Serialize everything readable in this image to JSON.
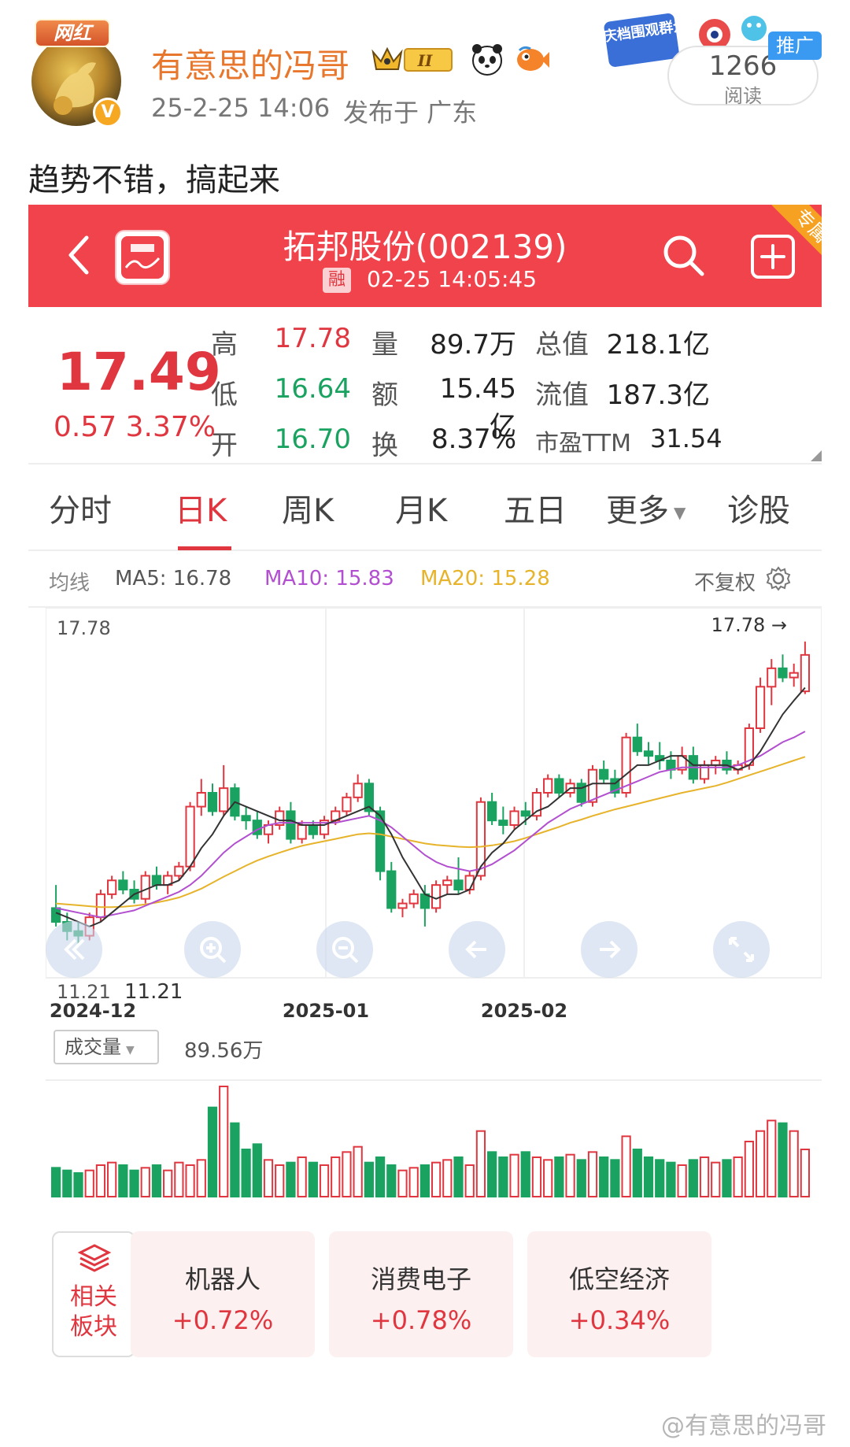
{
  "post": {
    "avatar_tag": "网红",
    "username": "有意思的冯哥",
    "level_badge": "II",
    "time": "25-2-25 14:06",
    "location": "发布于 广东",
    "read_count": "1266",
    "read_label": "阅读",
    "promo_label": "推广",
    "promo_art_text": "国庆档围观群众",
    "text": "趋势不错，搞起来"
  },
  "stock": {
    "name": "拓邦股份(002139)",
    "margin_badge": "融",
    "quote_time": "02-25 14:05:45",
    "ribbon": "专属",
    "price": "17.49",
    "change": "0.57 3.37%",
    "fields": [
      {
        "label": "高",
        "value": "17.78",
        "color": "red"
      },
      {
        "label": "量",
        "value": "89.7万",
        "color": "dark"
      },
      {
        "label": "总值",
        "value": "218.1亿",
        "color": "dark"
      },
      {
        "label": "低",
        "value": "16.64",
        "color": "green"
      },
      {
        "label": "额",
        "value": "15.45亿",
        "color": "dark"
      },
      {
        "label": "流值",
        "value": "187.3亿",
        "color": "dark"
      },
      {
        "label": "开",
        "value": "16.70",
        "color": "green"
      },
      {
        "label": "换",
        "value": "8.37%",
        "color": "dark"
      },
      {
        "label": "市盈TTM",
        "value": "31.54",
        "color": "dark"
      }
    ]
  },
  "tabs": [
    "分时",
    "日K",
    "周K",
    "月K",
    "五日",
    "更多",
    "诊股"
  ],
  "active_tab": "日K",
  "ma": {
    "label": "均线",
    "ma5": "MA5: 16.78",
    "ma10": "MA10: 15.83",
    "ma20": "MA20: 15.28",
    "adjust": "不复权"
  },
  "colors": {
    "up": "#e0363f",
    "down": "#1aa260",
    "ma5": "#333333",
    "ma10": "#b24fd0",
    "ma20": "#e6b32a"
  },
  "chart_data": {
    "type": "candlestick",
    "x_labels": [
      "2024-12",
      "2025-01",
      "2025-02"
    ],
    "high_label": "17.78",
    "high_marker_label": "17.78 →",
    "low_label": "11.21",
    "low_marker_label": "11.21",
    "ylim": [
      11.0,
      18.0
    ],
    "candles": [
      {
        "o": 12.0,
        "h": 12.5,
        "l": 11.6,
        "c": 11.7
      },
      {
        "o": 11.7,
        "h": 11.9,
        "l": 11.3,
        "c": 11.5
      },
      {
        "o": 11.5,
        "h": 11.7,
        "l": 11.21,
        "c": 11.4
      },
      {
        "o": 11.4,
        "h": 11.9,
        "l": 11.3,
        "c": 11.8
      },
      {
        "o": 11.8,
        "h": 12.4,
        "l": 11.7,
        "c": 12.3
      },
      {
        "o": 12.3,
        "h": 12.7,
        "l": 12.2,
        "c": 12.6
      },
      {
        "o": 12.6,
        "h": 12.8,
        "l": 12.3,
        "c": 12.4
      },
      {
        "o": 12.4,
        "h": 12.6,
        "l": 12.1,
        "c": 12.2
      },
      {
        "o": 12.2,
        "h": 12.8,
        "l": 12.1,
        "c": 12.7
      },
      {
        "o": 12.7,
        "h": 12.9,
        "l": 12.4,
        "c": 12.5
      },
      {
        "o": 12.5,
        "h": 12.8,
        "l": 12.3,
        "c": 12.7
      },
      {
        "o": 12.7,
        "h": 13.0,
        "l": 12.6,
        "c": 12.9
      },
      {
        "o": 12.9,
        "h": 14.3,
        "l": 12.8,
        "c": 14.2
      },
      {
        "o": 14.2,
        "h": 14.8,
        "l": 14.0,
        "c": 14.5
      },
      {
        "o": 14.5,
        "h": 14.7,
        "l": 14.0,
        "c": 14.1
      },
      {
        "o": 14.1,
        "h": 15.1,
        "l": 14.0,
        "c": 14.6
      },
      {
        "o": 14.6,
        "h": 14.7,
        "l": 13.9,
        "c": 14.0
      },
      {
        "o": 14.0,
        "h": 14.2,
        "l": 13.7,
        "c": 13.9
      },
      {
        "o": 13.9,
        "h": 14.1,
        "l": 13.5,
        "c": 13.6
      },
      {
        "o": 13.6,
        "h": 13.9,
        "l": 13.4,
        "c": 13.8
      },
      {
        "o": 13.8,
        "h": 14.2,
        "l": 13.7,
        "c": 14.1
      },
      {
        "o": 14.1,
        "h": 14.3,
        "l": 13.4,
        "c": 13.5
      },
      {
        "o": 13.5,
        "h": 13.9,
        "l": 13.4,
        "c": 13.8
      },
      {
        "o": 13.8,
        "h": 13.9,
        "l": 13.5,
        "c": 13.6
      },
      {
        "o": 13.6,
        "h": 14.0,
        "l": 13.5,
        "c": 13.9
      },
      {
        "o": 13.9,
        "h": 14.2,
        "l": 13.8,
        "c": 14.1
      },
      {
        "o": 14.1,
        "h": 14.5,
        "l": 14.0,
        "c": 14.4
      },
      {
        "o": 14.4,
        "h": 14.9,
        "l": 14.3,
        "c": 14.7
      },
      {
        "o": 14.7,
        "h": 14.8,
        "l": 14.0,
        "c": 14.1
      },
      {
        "o": 14.1,
        "h": 14.2,
        "l": 12.6,
        "c": 12.8
      },
      {
        "o": 12.8,
        "h": 13.0,
        "l": 11.9,
        "c": 12.0
      },
      {
        "o": 12.0,
        "h": 12.2,
        "l": 11.8,
        "c": 12.1
      },
      {
        "o": 12.1,
        "h": 12.4,
        "l": 12.0,
        "c": 12.3
      },
      {
        "o": 12.3,
        "h": 12.5,
        "l": 11.6,
        "c": 12.0
      },
      {
        "o": 12.0,
        "h": 12.6,
        "l": 11.9,
        "c": 12.5
      },
      {
        "o": 12.5,
        "h": 12.7,
        "l": 12.3,
        "c": 12.6
      },
      {
        "o": 12.6,
        "h": 13.1,
        "l": 12.3,
        "c": 12.4
      },
      {
        "o": 12.4,
        "h": 12.8,
        "l": 12.3,
        "c": 12.7
      },
      {
        "o": 12.7,
        "h": 14.4,
        "l": 12.6,
        "c": 14.3
      },
      {
        "o": 14.3,
        "h": 14.5,
        "l": 13.8,
        "c": 13.9
      },
      {
        "o": 13.9,
        "h": 14.2,
        "l": 13.6,
        "c": 13.8
      },
      {
        "o": 13.8,
        "h": 14.2,
        "l": 13.7,
        "c": 14.1
      },
      {
        "o": 14.1,
        "h": 14.3,
        "l": 13.8,
        "c": 14.0
      },
      {
        "o": 14.0,
        "h": 14.6,
        "l": 13.9,
        "c": 14.5
      },
      {
        "o": 14.5,
        "h": 14.9,
        "l": 14.4,
        "c": 14.8
      },
      {
        "o": 14.8,
        "h": 14.9,
        "l": 14.4,
        "c": 14.5
      },
      {
        "o": 14.5,
        "h": 14.8,
        "l": 14.4,
        "c": 14.7
      },
      {
        "o": 14.7,
        "h": 14.8,
        "l": 14.2,
        "c": 14.3
      },
      {
        "o": 14.3,
        "h": 15.1,
        "l": 14.2,
        "c": 15.0
      },
      {
        "o": 15.0,
        "h": 15.2,
        "l": 14.7,
        "c": 14.8
      },
      {
        "o": 14.8,
        "h": 15.0,
        "l": 14.4,
        "c": 14.5
      },
      {
        "o": 14.5,
        "h": 15.8,
        "l": 14.4,
        "c": 15.7
      },
      {
        "o": 15.7,
        "h": 16.0,
        "l": 15.3,
        "c": 15.4
      },
      {
        "o": 15.4,
        "h": 15.6,
        "l": 15.1,
        "c": 15.3
      },
      {
        "o": 15.3,
        "h": 15.6,
        "l": 15.0,
        "c": 15.2
      },
      {
        "o": 15.2,
        "h": 15.4,
        "l": 14.8,
        "c": 15.0
      },
      {
        "o": 15.0,
        "h": 15.5,
        "l": 14.9,
        "c": 15.3
      },
      {
        "o": 15.3,
        "h": 15.5,
        "l": 14.7,
        "c": 14.8
      },
      {
        "o": 14.8,
        "h": 15.2,
        "l": 14.7,
        "c": 15.1
      },
      {
        "o": 15.1,
        "h": 15.3,
        "l": 14.9,
        "c": 15.2
      },
      {
        "o": 15.2,
        "h": 15.4,
        "l": 14.9,
        "c": 15.0
      },
      {
        "o": 15.0,
        "h": 15.2,
        "l": 14.9,
        "c": 15.1
      },
      {
        "o": 15.1,
        "h": 16.0,
        "l": 15.0,
        "c": 15.9
      },
      {
        "o": 15.9,
        "h": 17.0,
        "l": 15.8,
        "c": 16.8
      },
      {
        "o": 16.8,
        "h": 17.4,
        "l": 16.4,
        "c": 17.2
      },
      {
        "o": 17.2,
        "h": 17.5,
        "l": 16.9,
        "c": 17.0
      },
      {
        "o": 17.0,
        "h": 17.3,
        "l": 16.8,
        "c": 17.1
      },
      {
        "o": 16.7,
        "h": 17.78,
        "l": 16.64,
        "c": 17.49
      }
    ],
    "ma5": [
      11.9,
      11.8,
      11.7,
      11.6,
      11.7,
      11.9,
      12.1,
      12.3,
      12.4,
      12.5,
      12.5,
      12.6,
      12.9,
      13.3,
      13.6,
      14.0,
      14.3,
      14.2,
      14.1,
      14.0,
      13.9,
      13.9,
      13.8,
      13.8,
      13.8,
      13.9,
      14.0,
      14.1,
      14.2,
      14.0,
      13.6,
      13.1,
      12.7,
      12.3,
      12.2,
      12.3,
      12.3,
      12.4,
      12.9,
      13.2,
      13.4,
      13.7,
      13.9,
      14.1,
      14.2,
      14.4,
      14.6,
      14.6,
      14.7,
      14.7,
      14.7,
      14.9,
      15.1,
      15.1,
      15.2,
      15.3,
      15.3,
      15.1,
      15.1,
      15.1,
      15.1,
      15.0,
      15.1,
      15.4,
      15.8,
      16.2,
      16.5,
      16.78
    ],
    "ma10": [
      12.0,
      11.95,
      11.9,
      11.85,
      11.8,
      11.85,
      11.9,
      11.95,
      12.05,
      12.15,
      12.25,
      12.35,
      12.5,
      12.7,
      12.95,
      13.2,
      13.4,
      13.55,
      13.7,
      13.8,
      13.85,
      13.85,
      13.85,
      13.85,
      13.85,
      13.85,
      13.9,
      13.95,
      14.0,
      13.9,
      13.75,
      13.55,
      13.35,
      13.15,
      13.0,
      12.9,
      12.85,
      12.8,
      12.85,
      12.95,
      13.1,
      13.25,
      13.45,
      13.65,
      13.85,
      14.0,
      14.15,
      14.25,
      14.35,
      14.45,
      14.55,
      14.65,
      14.75,
      14.85,
      14.95,
      15.0,
      15.05,
      15.05,
      15.05,
      15.05,
      15.05,
      15.1,
      15.2,
      15.3,
      15.45,
      15.6,
      15.7,
      15.83
    ],
    "ma20": [
      12.1,
      12.08,
      12.06,
      12.04,
      12.02,
      12.02,
      12.03,
      12.05,
      12.08,
      12.12,
      12.17,
      12.23,
      12.32,
      12.42,
      12.55,
      12.68,
      12.8,
      12.92,
      13.03,
      13.12,
      13.2,
      13.28,
      13.35,
      13.4,
      13.45,
      13.5,
      13.55,
      13.6,
      13.62,
      13.6,
      13.55,
      13.5,
      13.45,
      13.4,
      13.37,
      13.35,
      13.33,
      13.32,
      13.33,
      13.36,
      13.4,
      13.45,
      13.52,
      13.6,
      13.68,
      13.76,
      13.85,
      13.92,
      14.0,
      14.07,
      14.14,
      14.2,
      14.26,
      14.32,
      14.38,
      14.44,
      14.5,
      14.55,
      14.6,
      14.65,
      14.72,
      14.8,
      14.88,
      14.96,
      15.04,
      15.12,
      15.2,
      15.28
    ]
  },
  "volume": {
    "selector": "成交量",
    "value": "89.56万",
    "bars": [
      22,
      20,
      18,
      20,
      24,
      26,
      24,
      20,
      22,
      24,
      20,
      26,
      24,
      28,
      68,
      84,
      56,
      36,
      40,
      28,
      24,
      26,
      30,
      26,
      24,
      30,
      34,
      38,
      26,
      30,
      24,
      20,
      22,
      24,
      26,
      28,
      30,
      24,
      50,
      34,
      30,
      32,
      34,
      30,
      28,
      30,
      32,
      28,
      34,
      30,
      28,
      46,
      36,
      30,
      28,
      26,
      24,
      28,
      30,
      26,
      28,
      30,
      42,
      50,
      58,
      56,
      50,
      36
    ]
  },
  "sector_menu": {
    "line1": "相关",
    "line2": "板块"
  },
  "sectors": [
    {
      "name": "机器人",
      "change": "+0.72%"
    },
    {
      "name": "消费电子",
      "change": "+0.78%"
    },
    {
      "name": "低空经济",
      "change": "+0.34%"
    }
  ],
  "watermark": "@有意思的冯哥"
}
